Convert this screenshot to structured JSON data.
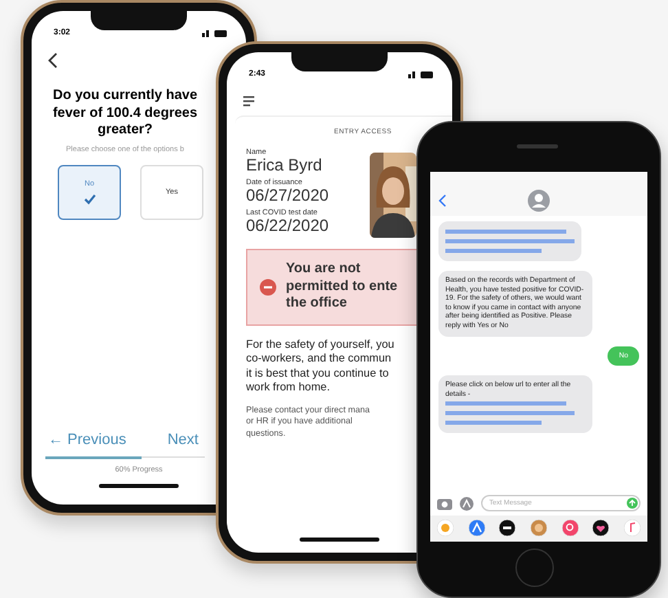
{
  "survey": {
    "status_time": "3:02",
    "question_lines": [
      "Do you currently have",
      "fever of 100.4 degrees",
      "greater?"
    ],
    "hint": "Please choose one of the options b",
    "options": [
      {
        "label": "No",
        "selected": true
      },
      {
        "label": "Yes",
        "selected": false
      }
    ],
    "previous": "← Previous",
    "next": "Next",
    "progress": {
      "level": 0.6
    },
    "progress_label": "60% Progress"
  },
  "pass": {
    "status_time": "2:43",
    "heading": "ENTRY ACCESS",
    "fields": [
      {
        "label": "Name",
        "value": "Erica Byrd"
      },
      {
        "label": "Date of issuance",
        "value": "06/27/2020"
      },
      {
        "label": "Last COVID test date",
        "value": "06/22/2020"
      }
    ],
    "alert_lines": [
      "You are not",
      "permitted to ente",
      "the office"
    ],
    "paragraphs": [
      [
        "For the safety of yourself, you",
        "co-workers, and the commun",
        "it is best that you continue to",
        "work from home."
      ],
      [
        "Please contact your direct mana",
        "or HR if you have additional",
        "questions."
      ]
    ]
  },
  "messages": {
    "items": [
      {
        "kind": "link_bubble"
      },
      {
        "kind": "received",
        "text": "Based on the records with Department of Health, you have tested positive for COVID-19. For the safety of others, we would want to know if you came in contact with anyone after being identified as Positive. Please reply with Yes or No"
      },
      {
        "kind": "sent",
        "text": "No"
      },
      {
        "kind": "received",
        "text": "Please click on below url to enter all the details - ",
        "link": true
      }
    ],
    "input_placeholder": "Text Message"
  }
}
